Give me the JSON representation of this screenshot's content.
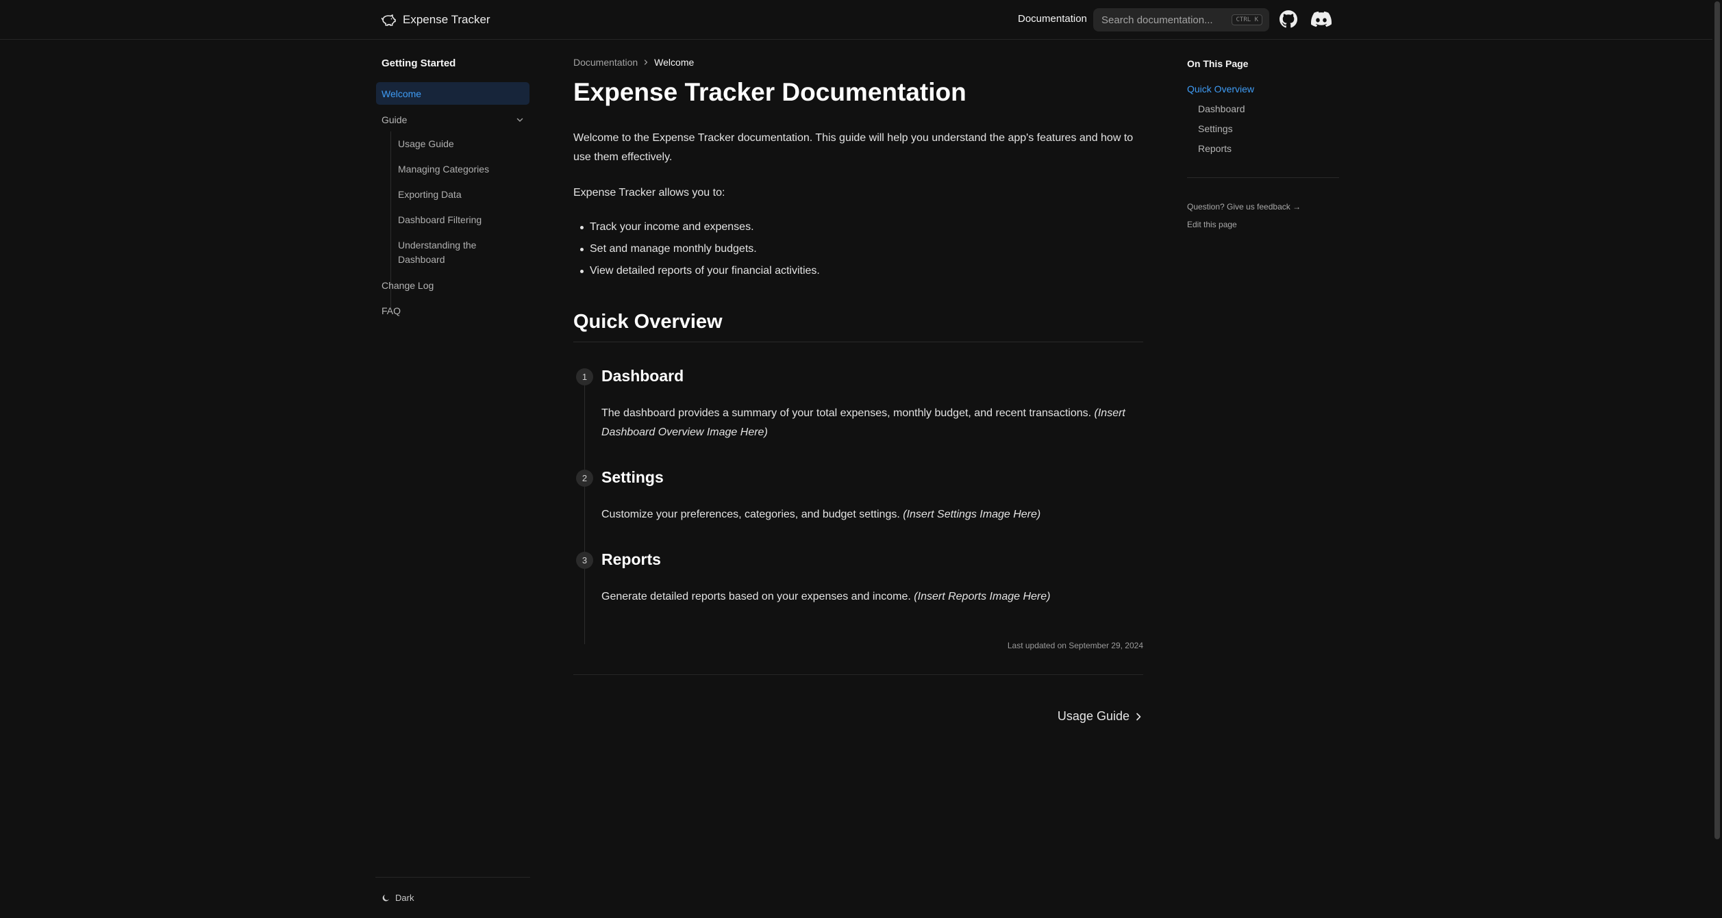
{
  "header": {
    "brand": "Expense Tracker",
    "nav_documentation": "Documentation",
    "search_placeholder": "Search documentation...",
    "search_shortcut": "CTRL K",
    "icons": [
      "piggy-bank-icon",
      "github-icon",
      "discord-icon"
    ]
  },
  "sidebar": {
    "heading": "Getting Started",
    "active_item": "Welcome",
    "guide_label": "Guide",
    "guide_children": [
      "Usage Guide",
      "Managing Categories",
      "Exporting Data",
      "Dashboard Filtering",
      "Understanding the Dashboard"
    ],
    "change_log": "Change Log",
    "faq": "FAQ",
    "theme_label": "Dark"
  },
  "breadcrumb": {
    "parent": "Documentation",
    "current": "Welcome"
  },
  "content": {
    "title": "Expense Tracker Documentation",
    "intro": "Welcome to the Expense Tracker documentation. This guide will help you understand the app's features and how to use them effectively.",
    "allows": "Expense Tracker allows you to:",
    "features": [
      "Track your income and expenses.",
      "Set and manage monthly budgets.",
      "View detailed reports of your financial activities."
    ],
    "section_title": "Quick Overview",
    "steps": [
      {
        "num": "1",
        "title": "Dashboard",
        "text": "The dashboard provides a summary of your total expenses, monthly budget, and recent transactions.",
        "note": "(Insert Dashboard Overview Image Here)"
      },
      {
        "num": "2",
        "title": "Settings",
        "text": "Customize your preferences, categories, and budget settings.",
        "note": "(Insert Settings Image Here)"
      },
      {
        "num": "3",
        "title": "Reports",
        "text": "Generate detailed reports based on your expenses and income.",
        "note": "(Insert Reports Image Here)"
      }
    ],
    "last_updated": "Last updated on September 29, 2024",
    "next_page": "Usage Guide"
  },
  "toc": {
    "heading": "On This Page",
    "items": [
      "Quick Overview",
      "Dashboard",
      "Settings",
      "Reports"
    ],
    "feedback": "Question? Give us feedback →",
    "edit": "Edit this page"
  },
  "colors": {
    "background": "#111111",
    "accent": "#3f9cf5",
    "active_bg": "#17253a"
  }
}
